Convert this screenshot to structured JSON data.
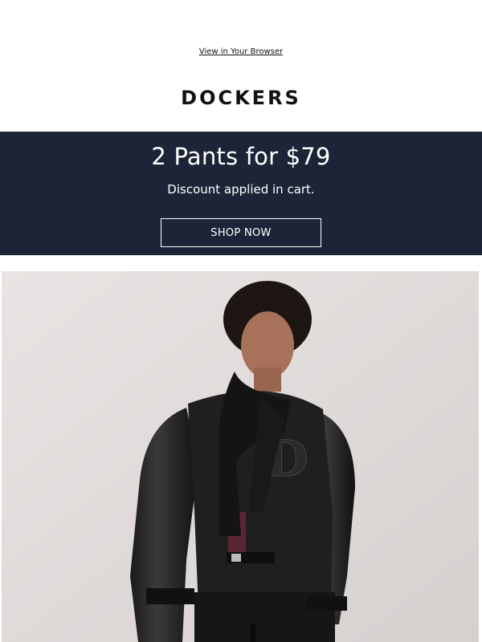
{
  "header": {
    "browser_link": "View in Your Browser",
    "logo_text": "DOCKERS"
  },
  "promo": {
    "title": "2 Pants for $79",
    "subtitle": "Discount applied in cart.",
    "cta": "SHOP NOW",
    "background": "#1b2537"
  },
  "hero": {
    "image_alt": "Model wearing black varsity jacket with leather sleeves and black knit scarf"
  },
  "colors": {
    "navy": "#1b2537",
    "text": "#111111",
    "white": "#ffffff"
  }
}
